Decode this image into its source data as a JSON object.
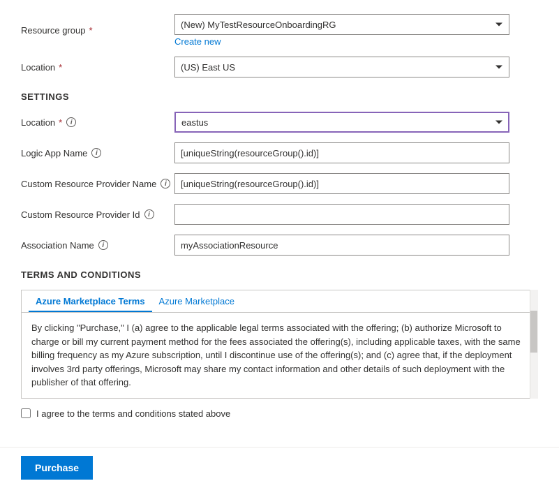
{
  "form": {
    "resource_group": {
      "label": "Resource group",
      "required": true,
      "value": "(New) MyTestResourceOnboardingRG",
      "create_new_text": "Create new"
    },
    "location_top": {
      "label": "Location",
      "required": true,
      "value": "(US) East US"
    },
    "settings_header": "SETTINGS",
    "location_settings": {
      "label": "Location",
      "required": true,
      "value": "eastus",
      "has_info": true
    },
    "logic_app_name": {
      "label": "Logic App Name",
      "has_info": true,
      "value": "[uniqueString(resourceGroup().id)]"
    },
    "custom_provider_name": {
      "label": "Custom Resource Provider Name",
      "has_info": true,
      "value": "[uniqueString(resourceGroup().id)]"
    },
    "custom_provider_id": {
      "label": "Custom Resource Provider Id",
      "has_info": true,
      "value": ""
    },
    "association_name": {
      "label": "Association Name",
      "has_info": true,
      "value": "myAssociationResource"
    }
  },
  "terms": {
    "header": "TERMS AND CONDITIONS",
    "tab1": "Azure Marketplace Terms",
    "tab2": "Azure Marketplace",
    "body": "By clicking \"Purchase,\" I (a) agree to the applicable legal terms associated with the offering; (b) authorize Microsoft to charge or bill my current payment method for the fees associated the offering(s), including applicable taxes, with the same billing frequency as my Azure subscription, until I discontinue use of the offering(s); and (c) agree that, if the deployment involves 3rd party offerings, Microsoft may share my contact information and other details of such deployment with the publisher of that offering.",
    "checkbox_label": "I agree to the terms and conditions stated above"
  },
  "footer": {
    "purchase_button": "Purchase"
  },
  "icons": {
    "info": "i",
    "chevron_down": "▾",
    "checkbox_empty": ""
  }
}
